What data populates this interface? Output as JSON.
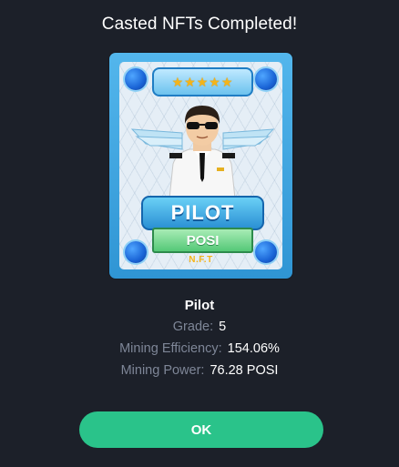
{
  "dialog": {
    "title": "Casted NFTs Completed!",
    "ok_label": "OK"
  },
  "card": {
    "rating_stars": "★★★★★",
    "rating_value": 5,
    "class_label": "PILOT",
    "token_label": "POSI",
    "nft_mark": "N.F.T",
    "icons": [
      "corner-orb-icon",
      "star-icon",
      "wings-icon",
      "pilot-avatar"
    ]
  },
  "nft": {
    "name": "Pilot",
    "stats": [
      {
        "label": "Grade:",
        "value": "5"
      },
      {
        "label": "Mining Efficiency:",
        "value": "154.06%"
      },
      {
        "label": "Mining Power:",
        "value": "76.28 POSI"
      }
    ]
  },
  "colors": {
    "background": "#1c2029",
    "accent": "#2ac38a",
    "muted_text": "#7e8697",
    "card_blue": "#2f95d4"
  }
}
